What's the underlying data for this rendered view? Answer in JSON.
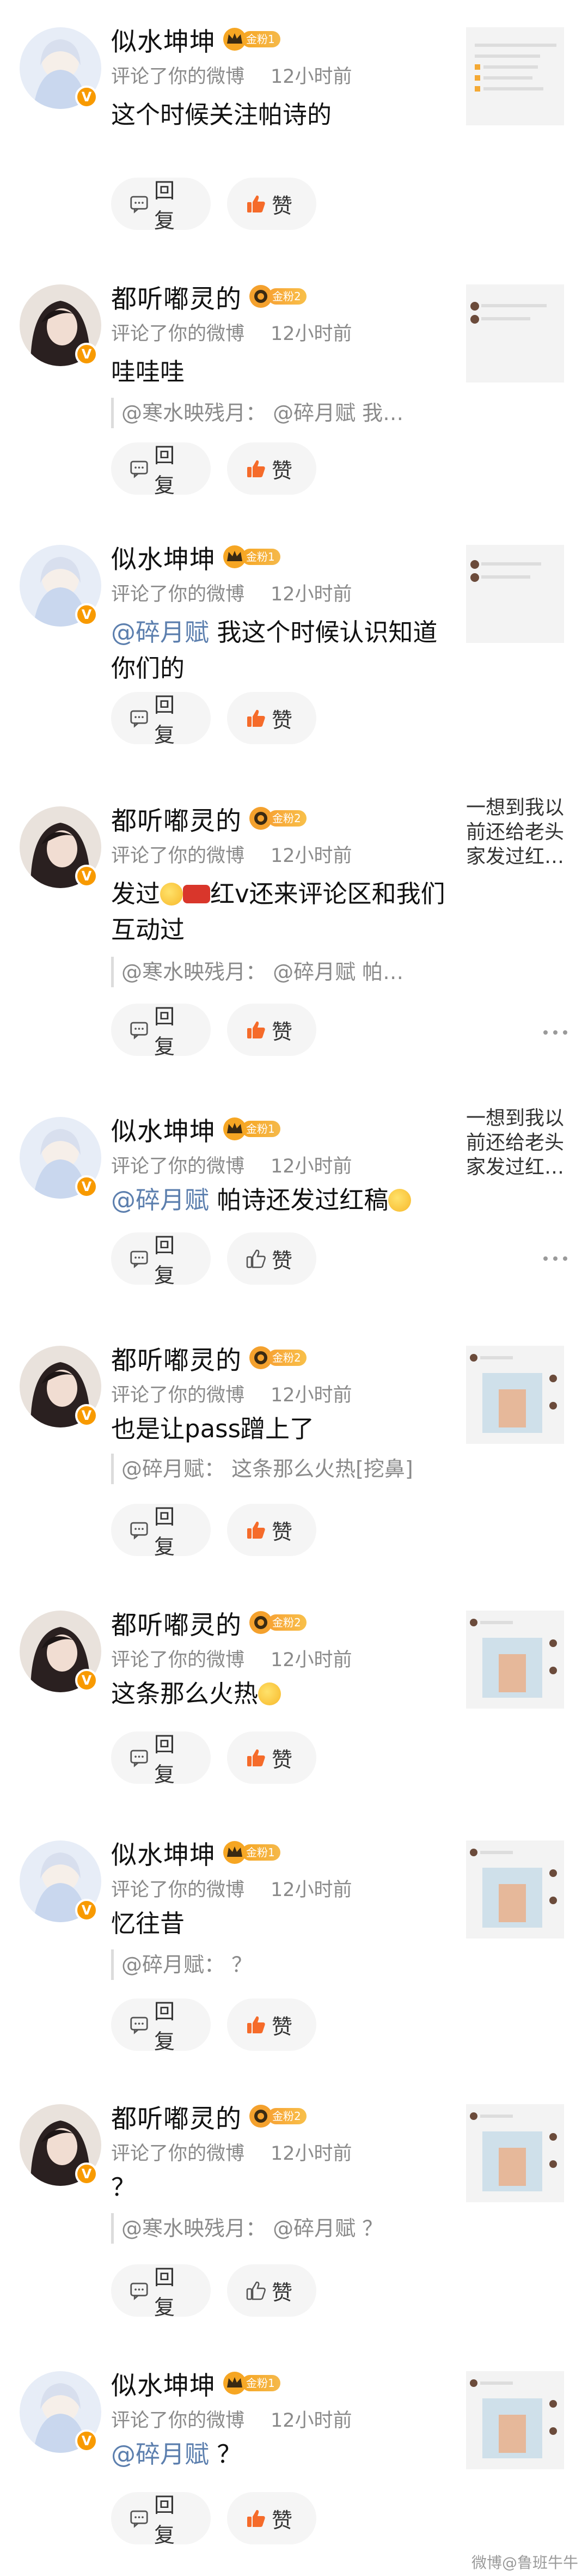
{
  "labels": {
    "reply": "回复",
    "like": "赞",
    "meta_action": "评论了你的微博",
    "meta_time": "12小时前"
  },
  "users": {
    "u1": {
      "name": "似水坤坤",
      "badge": "金粉1"
    },
    "u2": {
      "name": "都听嘟灵的",
      "badge": "金粉2"
    }
  },
  "comments": [
    {
      "user": "u1",
      "text": "这个时候关注帕诗的",
      "quote": "",
      "thumb": "screenshot",
      "thumb_text": ""
    },
    {
      "user": "u2",
      "text": "哇哇哇",
      "quote": "@寒水映残月：  @碎月赋  我…",
      "thumb": "screenshot",
      "thumb_text": ""
    },
    {
      "user": "u1",
      "mention": "@碎月赋",
      "text": " 我这个时候认识知道你们的",
      "quote": "",
      "thumb": "screenshot",
      "thumb_text": ""
    },
    {
      "user": "u2",
      "text_a": "发过",
      "text_b": "红v还来评论区和我们互动过",
      "quote": "@寒水映残月：  @碎月赋  帕…",
      "thumb": "",
      "thumb_text": "一想到我以前还给老头家发过红…"
    },
    {
      "user": "u1",
      "mention": "@碎月赋",
      "text": " 帕诗还发过红稿",
      "quote": "",
      "thumb": "",
      "thumb_text": "一想到我以前还给老头家发过红…"
    },
    {
      "user": "u2",
      "text": "也是让pass蹭上了",
      "quote": "@碎月赋：  这条那么火热[挖鼻]",
      "thumb": "photo",
      "thumb_text": ""
    },
    {
      "user": "u2",
      "text": "这条那么火热",
      "quote": "",
      "thumb": "photo",
      "thumb_text": ""
    },
    {
      "user": "u1",
      "text": "忆往昔",
      "quote": "@碎月赋：  ？",
      "thumb": "photo",
      "thumb_text": ""
    },
    {
      "user": "u2",
      "text": "？",
      "quote": "@寒水映残月：  @碎月赋  ？",
      "thumb": "photo",
      "thumb_text": ""
    },
    {
      "user": "u1",
      "mention": "@碎月赋",
      "text": " ？",
      "quote": "",
      "thumb": "photo",
      "thumb_text": ""
    }
  ],
  "watermark": "微博@鲁班牛牛",
  "colors": {
    "accent_badge": "#f89a00",
    "mention": "#5c7fae",
    "like_icon": "#f56b2a",
    "bg": "#f2f2f2"
  }
}
